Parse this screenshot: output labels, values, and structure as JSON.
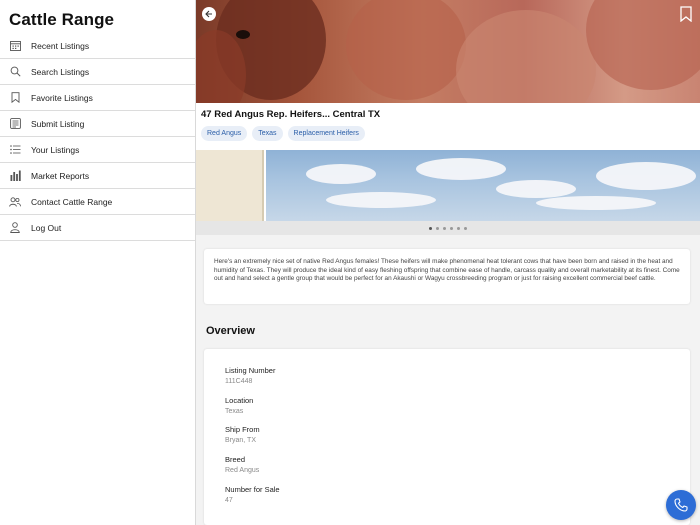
{
  "app": {
    "title": "Cattle Range"
  },
  "menu": {
    "items": [
      {
        "label": "Recent Listings",
        "icon": "calendar-icon"
      },
      {
        "label": "Search Listings",
        "icon": "search-icon"
      },
      {
        "label": "Favorite Listings",
        "icon": "bookmark-icon"
      },
      {
        "label": "Submit Listing",
        "icon": "form-icon"
      },
      {
        "label": "Your Listings",
        "icon": "list-icon"
      },
      {
        "label": "Market Reports",
        "icon": "bar-chart-icon"
      },
      {
        "label": "Contact Cattle Range",
        "icon": "people-icon"
      },
      {
        "label": "Log Out",
        "icon": "person-icon"
      }
    ]
  },
  "listing": {
    "title": "47 Red Angus Rep. Heifers... Central TX",
    "tags": [
      "Red Angus",
      "Texas",
      "Replacement Heifers"
    ],
    "gallery": {
      "dot_count": 6,
      "active_index": 0
    },
    "description": "Here's an extremely nice set of native Red Angus females! These heifers will make phenomenal heat tolerant cows that have been born and raised in the heat and humidity of Texas. They will produce the ideal kind of easy fleshing offspring that combine ease of handle, carcass quality and overall marketability at its finest. Come out and hand select a gentle group that would be perfect for an Akaushi or Wagyu crossbreeding program or just for raising excellent commercial beef cattle.",
    "overview_heading": "Overview",
    "fields": [
      {
        "label": "Listing Number",
        "value": "111C448"
      },
      {
        "label": "Location",
        "value": "Texas"
      },
      {
        "label": "Ship From",
        "value": "Bryan, TX"
      },
      {
        "label": "Breed",
        "value": "Red Angus"
      },
      {
        "label": "Number for Sale",
        "value": "47"
      }
    ]
  },
  "colors": {
    "accent": "#2d6dd6",
    "tag_bg": "#e8eef7",
    "tag_text": "#2a5ea8"
  }
}
